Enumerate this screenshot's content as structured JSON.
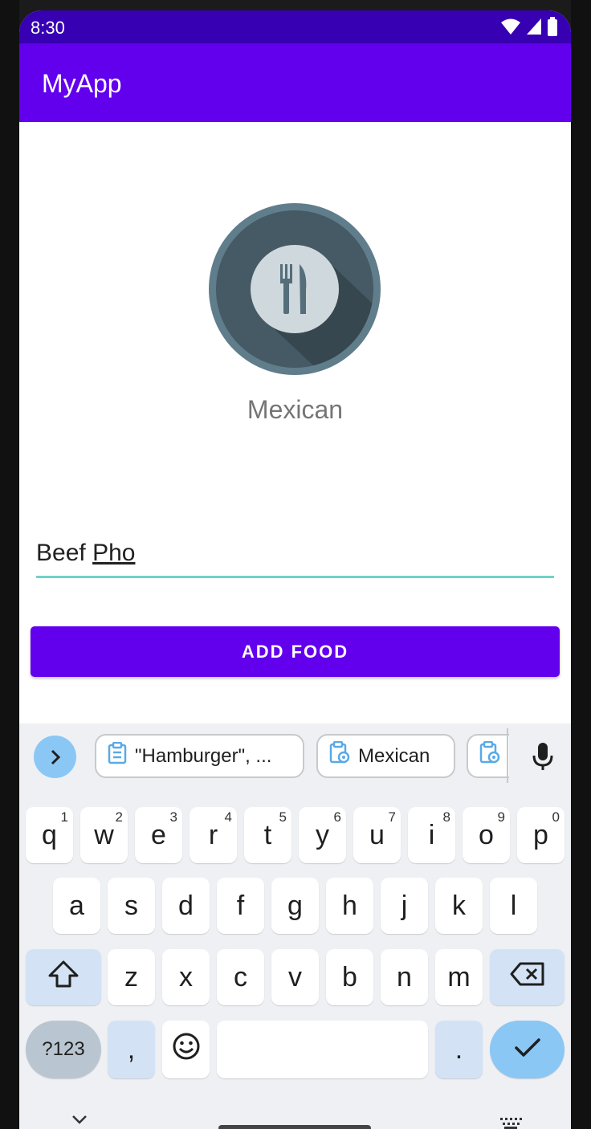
{
  "status_bar": {
    "time": "8:30",
    "icons": [
      "wifi-icon",
      "cell-signal-icon",
      "battery-icon"
    ]
  },
  "app_bar": {
    "title": "MyApp"
  },
  "main": {
    "food_logo_icon": "fork-knife-icon",
    "category": "Mexican",
    "food_input": {
      "value": "Beef Pho",
      "value_plain": "Beef ",
      "value_underlined": "Pho"
    },
    "add_button_label": "ADD FOOD"
  },
  "keyboard": {
    "suggestions": [
      {
        "label": "\"Hamburger\", ...",
        "icon": "clipboard-icon"
      },
      {
        "label": "Mexican",
        "icon": "clipboard-location-icon"
      },
      {
        "label": "",
        "icon": "clipboard-location-icon"
      }
    ],
    "row1": [
      {
        "key": "q",
        "hint": "1"
      },
      {
        "key": "w",
        "hint": "2"
      },
      {
        "key": "e",
        "hint": "3"
      },
      {
        "key": "r",
        "hint": "4"
      },
      {
        "key": "t",
        "hint": "5"
      },
      {
        "key": "y",
        "hint": "6"
      },
      {
        "key": "u",
        "hint": "7"
      },
      {
        "key": "i",
        "hint": "8"
      },
      {
        "key": "o",
        "hint": "9"
      },
      {
        "key": "p",
        "hint": "0"
      }
    ],
    "row2": [
      "a",
      "s",
      "d",
      "f",
      "g",
      "h",
      "j",
      "k",
      "l"
    ],
    "row3": [
      "z",
      "x",
      "c",
      "v",
      "b",
      "n",
      "m"
    ],
    "row4": {
      "symbols": "?123",
      "comma": ",",
      "period": "."
    }
  },
  "colors": {
    "primary": "#6200ee",
    "primary_dark": "#3700b3",
    "input_underline": "#6fd3c8",
    "keyboard_accent": "#8ac7f5"
  }
}
